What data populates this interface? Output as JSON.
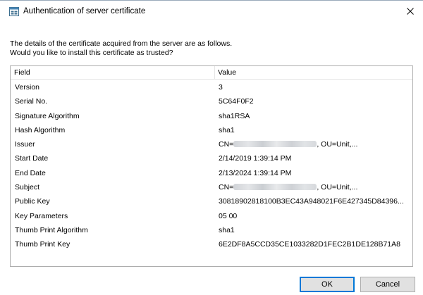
{
  "window": {
    "title": "Authentication of server certificate",
    "close_icon": "close-icon",
    "app_icon": "certificate-window-icon"
  },
  "description": {
    "line1": "The details of the certificate acquired from the server are as follows.",
    "line2": "Would you like to install this certificate as trusted?"
  },
  "table": {
    "headers": {
      "field": "Field",
      "value": "Value"
    },
    "rows": [
      {
        "field": "Version",
        "value": "3"
      },
      {
        "field": "Serial No.",
        "value": "5C64F0F2"
      },
      {
        "field": "Signature Algorithm",
        "value": "sha1RSA"
      },
      {
        "field": "Hash Algorithm",
        "value": "sha1"
      },
      {
        "field": "Issuer",
        "value_prefix": "CN=",
        "value_suffix": ", OU=Unit,..."
      },
      {
        "field": "Start Date",
        "value": "2/14/2019 1:39:14 PM"
      },
      {
        "field": "End Date",
        "value": "2/13/2024 1:39:14 PM"
      },
      {
        "field": "Subject",
        "value_prefix": "CN=",
        "value_suffix": ", OU=Unit,..."
      },
      {
        "field": "Public Key",
        "value": "30818902818100B3EC43A948021F6E427345D84396..."
      },
      {
        "field": "Key Parameters",
        "value": "05 00"
      },
      {
        "field": "Thumb Print Algorithm",
        "value": "sha1"
      },
      {
        "field": "Thumb Print Key",
        "value": "6E2DF8A5CCD35CE1033282D1FEC2B1DE128B71A8"
      }
    ]
  },
  "buttons": {
    "ok": "OK",
    "cancel": "Cancel"
  },
  "colors": {
    "accent": "#0078d7",
    "button_face": "#e1e1e1",
    "border": "#adadad"
  }
}
